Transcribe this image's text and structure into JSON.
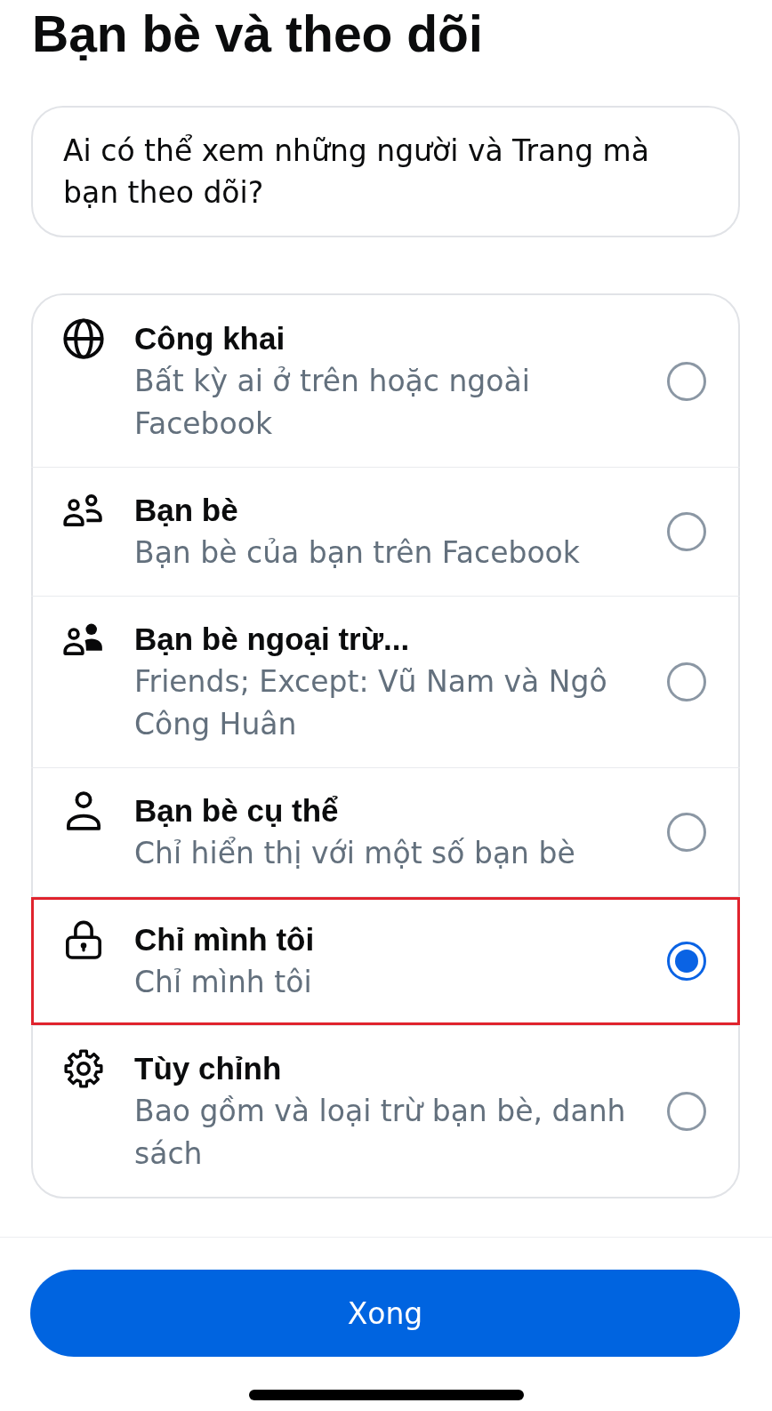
{
  "header": {
    "title": "Bạn bè và theo dõi"
  },
  "question": {
    "text": "Ai có thể xem những người và Trang mà bạn theo dõi?"
  },
  "options": [
    {
      "kind": "public",
      "title": "Công khai",
      "description": "Bất kỳ ai ở trên hoặc ngoài Facebook",
      "selected": false,
      "highlighted": false
    },
    {
      "kind": "friends",
      "title": "Bạn bè",
      "description": "Bạn bè của bạn trên Facebook",
      "selected": false,
      "highlighted": false
    },
    {
      "kind": "except",
      "title": "Bạn bè ngoại trừ...",
      "description": "Friends; Except: Vũ Nam và Ngô Công Huân",
      "selected": false,
      "highlighted": false
    },
    {
      "kind": "specific",
      "title": "Bạn bè cụ thể",
      "description": "Chỉ hiển thị với một số bạn bè",
      "selected": false,
      "highlighted": false
    },
    {
      "kind": "private",
      "title": "Chỉ mình tôi",
      "description": "Chỉ mình tôi",
      "selected": true,
      "highlighted": true
    },
    {
      "kind": "custom",
      "title": "Tùy chỉnh",
      "description": "Bao gồm và loại trừ bạn bè, danh sách",
      "selected": false,
      "highlighted": false
    }
  ],
  "done_button": {
    "label": "Xong"
  }
}
